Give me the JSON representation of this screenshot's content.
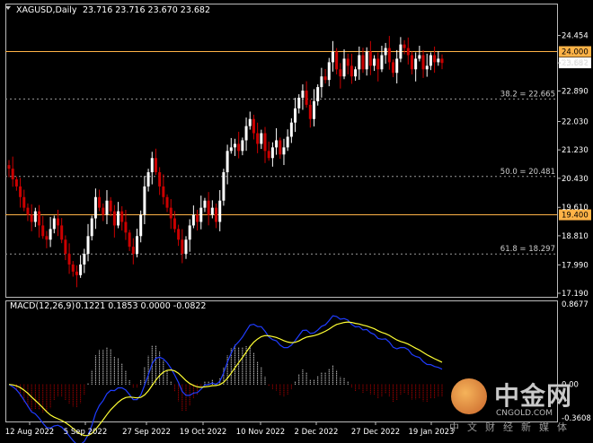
{
  "header": {
    "symbol": "XAGUSD,Daily",
    "ohlc": "23.716 23.716 23.670 23.682"
  },
  "macd_header": {
    "label": "MACD(12,26,9)",
    "values": "0.1221 0.1853 0.0000 -0.0822"
  },
  "colors": {
    "background": "#000000",
    "bull_candle": "#ffffff",
    "bear_candle": "#cc0000",
    "horizontal_level": "#ffb347",
    "fib_line": "#9a9a9a",
    "macd_line": "#1f3cff",
    "signal_line": "#ffff33",
    "hist_positive": "#ffffff",
    "hist_negative": "#cc0000"
  },
  "chart_data": [
    {
      "type": "candlestick",
      "title": "XAGUSD,Daily",
      "ylim": [
        17.19,
        25.1
      ],
      "y_ticks": [
        "24.454",
        "23.682",
        "22.890",
        "22.030",
        "21.230",
        "20.430",
        "19.610",
        "18.810",
        "17.990",
        "17.190"
      ],
      "x_ticks": [
        "12 Aug 2022",
        "5 Sep 2022",
        "27 Sep 2022",
        "19 Oct 2022",
        "10 Nov 2022",
        "2 Dec 2022",
        "27 Dec 2022",
        "19 Jan 2023"
      ],
      "levels": [
        {
          "price": 24.0,
          "label": "24.000"
        },
        {
          "price": 19.4,
          "label": "19.400"
        }
      ],
      "current_price": {
        "price": 23.682,
        "label": "23.682"
      },
      "fib_levels": [
        {
          "price": 22.665,
          "label": "38.2 = 22.665"
        },
        {
          "price": 20.481,
          "label": "50.0 = 20.481"
        },
        {
          "price": 18.297,
          "label": "61.8 = 18.297"
        }
      ],
      "close": [
        20.7,
        20.4,
        20.2,
        19.9,
        19.6,
        19.4,
        19.2,
        19.5,
        19.1,
        18.8,
        18.7,
        19.0,
        19.3,
        19.1,
        18.7,
        18.3,
        18.0,
        17.8,
        17.7,
        18.0,
        18.3,
        18.8,
        19.3,
        19.9,
        19.6,
        19.4,
        19.8,
        19.5,
        19.1,
        19.5,
        19.2,
        18.9,
        18.5,
        18.3,
        18.8,
        19.4,
        20.2,
        20.6,
        21.0,
        20.6,
        20.2,
        19.9,
        19.6,
        19.3,
        19.0,
        18.7,
        18.3,
        18.7,
        19.1,
        19.4,
        19.2,
        19.6,
        19.8,
        19.4,
        19.6,
        19.2,
        19.8,
        20.6,
        21.2,
        21.3,
        21.4,
        21.2,
        21.5,
        21.9,
        22.1,
        21.7,
        21.4,
        21.7,
        21.2,
        21.0,
        21.3,
        21.5,
        21.1,
        21.3,
        21.6,
        22.0,
        22.4,
        22.7,
        22.9,
        22.5,
        22.1,
        22.6,
        23.0,
        23.3,
        23.2,
        23.7,
        24.0,
        23.5,
        23.3,
        23.8,
        23.6,
        23.3,
        23.5,
        23.9,
        23.5,
        24.0,
        23.6,
        23.8,
        23.5,
        23.9,
        24.1,
        23.7,
        23.4,
        23.8,
        24.2,
        24.1,
        23.9,
        23.5,
        23.8,
        23.9,
        23.5,
        23.6,
        23.9,
        23.7,
        23.8,
        23.68
      ],
      "start_open": 20.8
    },
    {
      "type": "macd",
      "title": "MACD(12,26,9)",
      "params": [
        12,
        26,
        9
      ],
      "last_values": {
        "macd": 0.1221,
        "signal": 0.1853,
        "histogram": 0.0,
        "diff": -0.0822
      },
      "ylim": [
        -0.3608,
        0.8677
      ],
      "y_ticks": [
        "0.8677",
        "0.00",
        "-0.3608"
      ]
    }
  ],
  "logo": {
    "name": "中金网",
    "url": "CNGOLD.COM",
    "tagline": "中文财经新媒体"
  }
}
